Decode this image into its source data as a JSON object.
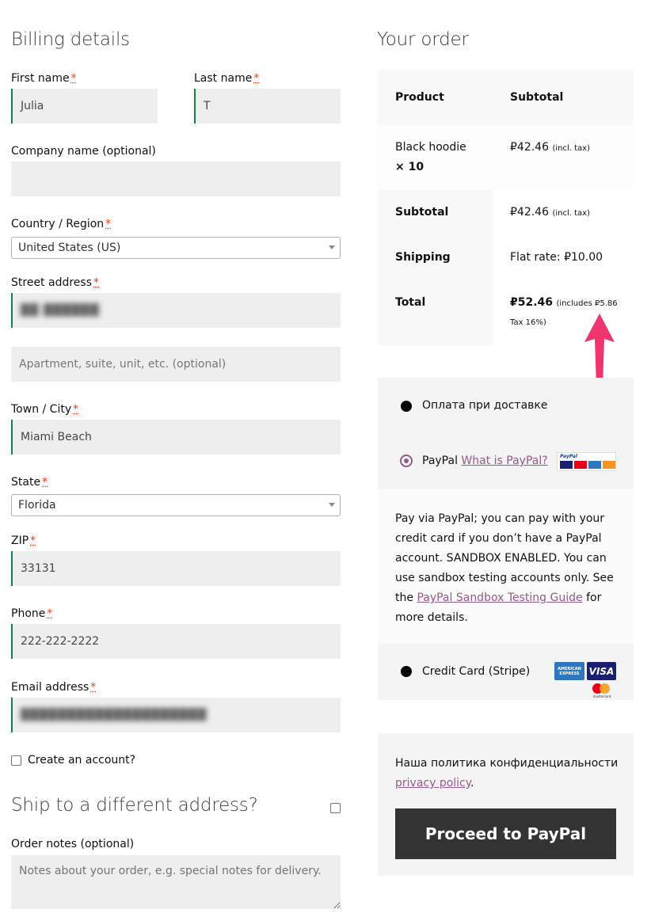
{
  "billing": {
    "heading": "Billing details",
    "first_name": {
      "label": "First name",
      "value": "Julia"
    },
    "last_name": {
      "label": "Last name",
      "value": "T"
    },
    "company": {
      "label": "Company name (optional)",
      "value": ""
    },
    "country": {
      "label": "Country / Region",
      "value": "United States (US)"
    },
    "street": {
      "label": "Street address",
      "value": "██ ██████",
      "placeholder2": "Apartment, suite, unit, etc. (optional)"
    },
    "city": {
      "label": "Town / City",
      "value": "Miami Beach"
    },
    "state": {
      "label": "State",
      "value": "Florida"
    },
    "zip": {
      "label": "ZIP",
      "value": "33131"
    },
    "phone": {
      "label": "Phone",
      "value": "222-222-2222"
    },
    "email": {
      "label": "Email address",
      "value": "████████████████████"
    },
    "required_mark": "*",
    "create_account": "Create an account?",
    "ship_different": "Ship to a different address?",
    "order_notes": {
      "label": "Order notes (optional)",
      "placeholder": "Notes about your order, e.g. special notes for delivery."
    }
  },
  "order": {
    "heading": "Your order",
    "col_product": "Product",
    "col_subtotal": "Subtotal",
    "item": {
      "name": "Black hoodie",
      "qty": "× 10",
      "price": "₽42.46",
      "tax_note": "(incl. tax)"
    },
    "subtotal": {
      "label": "Subtotal",
      "value": "₽42.46",
      "tax_note": "(incl. tax)"
    },
    "shipping": {
      "label": "Shipping",
      "value": "Flat rate: ₽10.00"
    },
    "total": {
      "label": "Total",
      "value": "₽52.46",
      "note_line1": "(includes ₽5.86",
      "note_line2": "Tax 16%)"
    }
  },
  "payment": {
    "cod_label": "Оплата при доставке",
    "paypal_label": "PayPal",
    "paypal_link": "What is PayPal?",
    "paypal_badge": "PayPal",
    "paypal_desc_1": "Pay via PayPal; you can pay with your credit card if you don’t have a PayPal account. SANDBOX ENABLED. You can use sandbox testing accounts only. See the ",
    "paypal_desc_link": "PayPal Sandbox Testing Guide",
    "paypal_desc_2": " for more details.",
    "stripe_label": "Credit Card (Stripe)",
    "amex": "AMERICAN EXPRESS",
    "visa": "VISA",
    "mastercard": "mastercard",
    "privacy_text": "Наша политика конфиденциальности",
    "privacy_link": "privacy policy",
    "privacy_period": ".",
    "button": "Proceed to PayPal"
  },
  "colors": {
    "accent_purple": "#96588a",
    "valid_green": "#0f834d",
    "required_red": "#e2401c",
    "arrow_pink": "#f0346e"
  }
}
